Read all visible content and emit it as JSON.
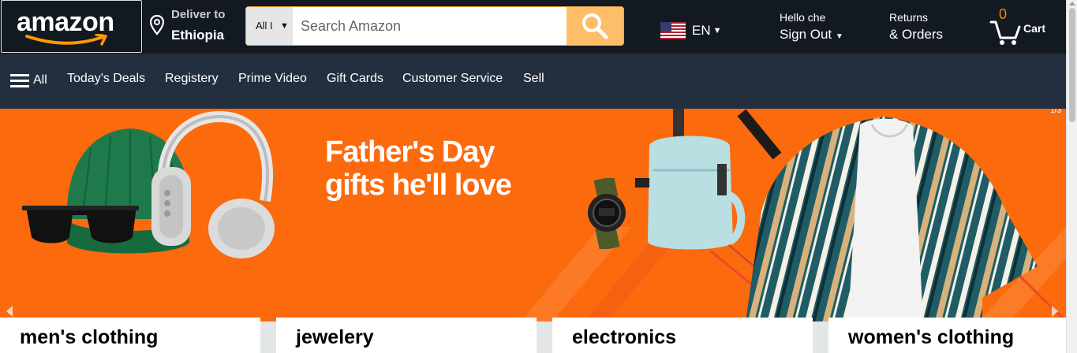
{
  "header": {
    "logo_text": "amazon",
    "deliver": {
      "line1": "Deliver to",
      "line2": "Ethiopia"
    },
    "search": {
      "category": "All I",
      "placeholder": "Search Amazon",
      "value": ""
    },
    "language": {
      "code": "EN"
    },
    "account": {
      "line1": "Hello che",
      "line2": "Sign Out"
    },
    "returns": {
      "line1": "Returns",
      "line2": "& Orders"
    },
    "cart": {
      "count": "0",
      "label": "Cart"
    }
  },
  "subnav": {
    "all_label": "All",
    "items": [
      "Today's Deals",
      "Registery",
      "Prime Video",
      "Gift Cards",
      "Customer Service",
      "Sell"
    ]
  },
  "hero": {
    "headline_line1": "Father's Day",
    "headline_line2": "gifts he'll love",
    "slide_indicator": "1/3"
  },
  "categories": [
    "men's clothing",
    "jewelery",
    "electronics",
    "women's clothing"
  ],
  "colors": {
    "nav_dark": "#131921",
    "subnav": "#232f3e",
    "search_button": "#febd69",
    "hero_orange": "#fb6a0d",
    "cart_count": "#f08804"
  }
}
